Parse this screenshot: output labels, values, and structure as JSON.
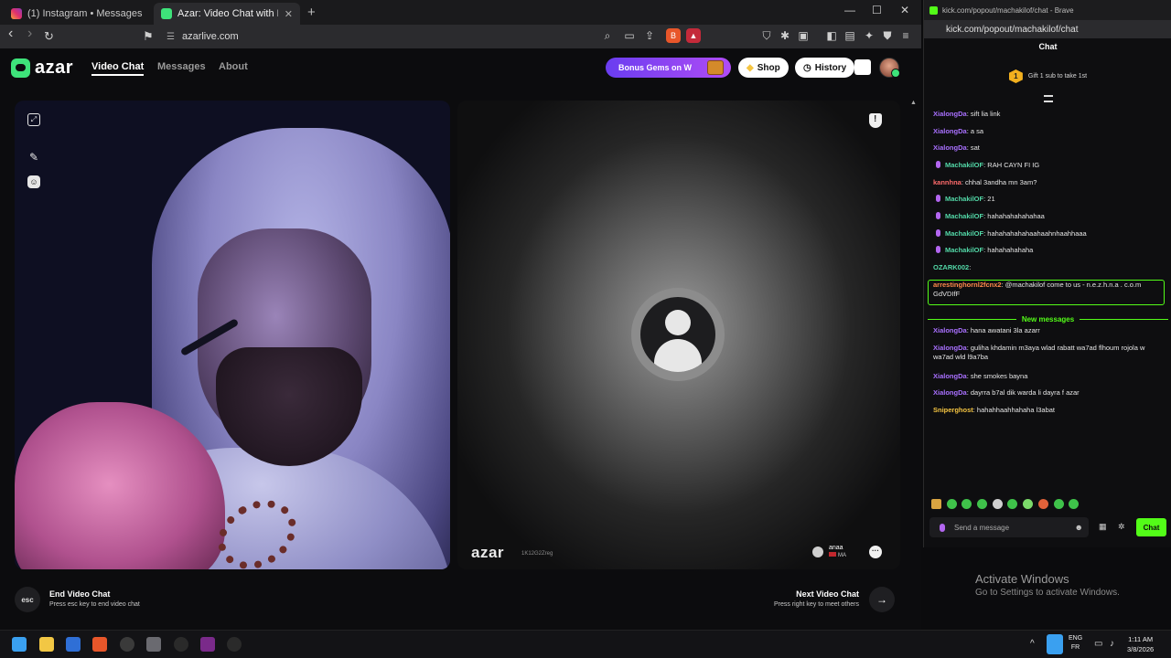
{
  "browser": {
    "tabs": [
      {
        "title": "(1) Instagram • Messages"
      },
      {
        "title": "Azar: Video Chat with New Pe"
      }
    ],
    "new_tab": "+",
    "url": "azarlive.com",
    "window_controls": {
      "minimize": "—",
      "maximize": "☐",
      "close": "✕"
    },
    "nav": {
      "back": "‹",
      "forward": "›",
      "reload": "↻"
    }
  },
  "azar": {
    "logo_text": "azar",
    "nav": [
      {
        "label": "Video Chat",
        "active": true
      },
      {
        "label": "Messages",
        "active": false
      },
      {
        "label": "About",
        "active": false
      }
    ],
    "bonus_banner": "Bonus Gems on W",
    "shop_label": "Shop",
    "history_label": "History",
    "watermark": "azar",
    "watermark_id": "1K12G2Zreg",
    "peer": {
      "name": "anaa",
      "country": "MA"
    },
    "end_key": "esc",
    "end_title": "End Video Chat",
    "end_sub": "Press esc key to end video chat",
    "next_title": "Next Video Chat",
    "next_sub": "Press right key to meet others",
    "next_arrow": "→"
  },
  "chat_window": {
    "title": "kick.com/popout/machakilof/chat - Brave",
    "url": "kick.com/popout/machakilof/chat",
    "header": "Chat",
    "gift_text": "Gift 1 sub to take 1st",
    "gift_badge": "1",
    "messages": [
      {
        "user": "XialongDa",
        "text": ": sift lia link",
        "color": "#a970ff",
        "mic": false
      },
      {
        "user": "XialongDa",
        "text": ": a sa",
        "color": "#a970ff",
        "mic": false
      },
      {
        "user": "XialongDa",
        "text": ": sat",
        "color": "#a970ff",
        "mic": false
      },
      {
        "user": "MachakilOF",
        "text": ": RAH CAYN FI IG",
        "color": "#53d9a8",
        "mic": true
      },
      {
        "user": "kannhna",
        "text": ": chhal 3andha mn 3am?",
        "color": "#ff6b6b",
        "mic": false
      },
      {
        "user": "MachakilOF",
        "text": ": 21",
        "color": "#53d9a8",
        "mic": true
      },
      {
        "user": "MachakilOF",
        "text": ": hahahahahahahaa",
        "color": "#53d9a8",
        "mic": true
      },
      {
        "user": "MachakilOF",
        "text": ": hahahahahahaahaahnhaahhaaa",
        "color": "#53d9a8",
        "mic": true
      },
      {
        "user": "MachakilOF",
        "text": ": hahahahahaha",
        "color": "#53d9a8",
        "mic": true
      },
      {
        "user": "OZARK002",
        "text": ":",
        "color": "#53d9a8",
        "mic": false
      },
      {
        "user": "arrestinghornl2fcnx2",
        "text": ": @machakilof come to us - n.e.z.h.n.a . c.o.m GdVDIfF",
        "color": "#ff8a4c",
        "mic": false
      },
      {
        "user": "XialongDa",
        "text": ": hana awatani 3la azarr",
        "color": "#a970ff",
        "mic": false
      },
      {
        "user": "XialongDa",
        "text": ": guliha khdamin m3aya wlad rabatt wa7ad flhoum rojola w wa7ad wld l9a7ba",
        "color": "#a970ff",
        "mic": false
      },
      {
        "user": "XialongDa",
        "text": ": she smokes bayna",
        "color": "#a970ff",
        "mic": false
      },
      {
        "user": "XialongDa",
        "text": ": dayrra b7al dik warda li dayra f azar",
        "color": "#a970ff",
        "mic": false
      },
      {
        "user": "Sniperghost",
        "text": ": hahahhaahhahaha l3abat",
        "color": "#f5c542",
        "mic": false
      }
    ],
    "new_messages_label": "New messages",
    "input_placeholder": "Send a message",
    "send_label": "Chat"
  },
  "os": {
    "activate_title": "Activate Windows",
    "activate_sub": "Go to Settings to activate Windows.",
    "lang_top": "ENG",
    "lang_bottom": "FR",
    "time": "1:11 AM",
    "date": "3/8/2026"
  },
  "colors": {
    "kick_green": "#53fc18",
    "azar_green": "#3ee37a",
    "bonus_gradient_start": "#6a3df0",
    "bonus_gradient_end": "#b04cf5"
  }
}
